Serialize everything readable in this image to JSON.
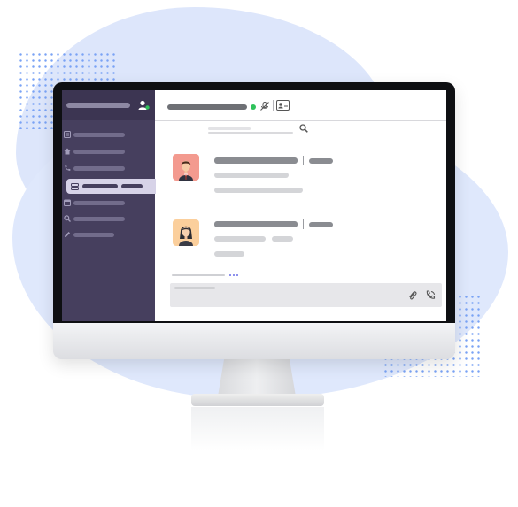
{
  "sidebar": {
    "items": [
      {
        "icon": "list-icon"
      },
      {
        "icon": "home-icon"
      },
      {
        "icon": "phone-icon"
      },
      {
        "icon": "database-icon",
        "active": true
      },
      {
        "icon": "calendar-icon"
      },
      {
        "icon": "search-icon"
      },
      {
        "icon": "edit-icon"
      }
    ]
  },
  "topbar": {
    "status_color": "#2fc25b",
    "icons": [
      "microphone-off-icon",
      "contact-card-icon"
    ]
  },
  "conversations": [
    {
      "avatar": "male-avatar",
      "avatar_bg": "#f39a8f"
    },
    {
      "avatar": "female-avatar",
      "avatar_bg": "#fbcf9c"
    }
  ],
  "composer": {
    "icons": [
      "paperclip-icon",
      "phone-icon"
    ]
  },
  "colors": {
    "sidebar": "#463f5e",
    "sidebar_header": "#3c3552",
    "active_item": "#d7d3e8",
    "accent_blob": "#dbe5fb"
  }
}
